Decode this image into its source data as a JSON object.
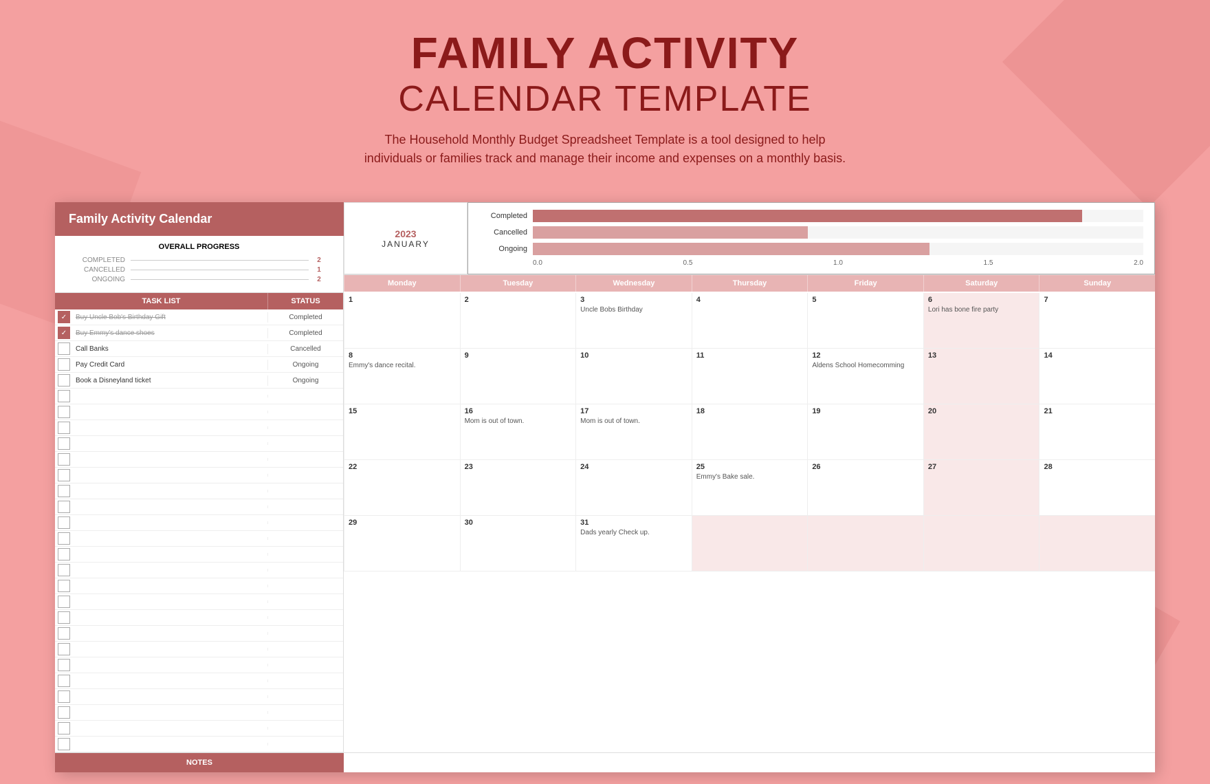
{
  "page": {
    "title_line1": "FAMILY ACTIVITY",
    "title_line2": "CALENDAR TEMPLATE",
    "subtitle": "The Household Monthly Budget Spreadsheet Template is a tool designed to help\nindividuals or families track and manage their income and expenses on a monthly basis."
  },
  "spreadsheet": {
    "title": "Family Activity Calendar",
    "year": "2023",
    "month": "JANUARY",
    "progress": {
      "title": "OVERALL PROGRESS",
      "completed_label": "COMPLETED",
      "completed_value": "2",
      "cancelled_label": "CANCELLED",
      "cancelled_value": "1",
      "ongoing_label": "ONGOING",
      "ongoing_value": "2"
    },
    "chart": {
      "completed_label": "Completed",
      "cancelled_label": "Cancelled",
      "ongoing_label": "Ongoing",
      "axis": [
        "0.0",
        "0.5",
        "1.0",
        "1.5",
        "2.0"
      ]
    },
    "tasks": [
      {
        "checked": true,
        "name": "Buy Uncle Bob's Birthday Gift",
        "strikethrough": true,
        "status": "Completed"
      },
      {
        "checked": true,
        "name": "Buy Emmy's dance shoes",
        "strikethrough": true,
        "status": "Completed"
      },
      {
        "checked": false,
        "name": "Call Banks",
        "strikethrough": false,
        "status": "Cancelled"
      },
      {
        "checked": false,
        "name": "Pay Credit Card",
        "strikethrough": false,
        "status": "Ongoing"
      },
      {
        "checked": false,
        "name": "Book a Disneyland ticket",
        "strikethrough": false,
        "status": "Ongoing"
      },
      {
        "checked": false,
        "name": "",
        "strikethrough": false,
        "status": ""
      },
      {
        "checked": false,
        "name": "",
        "strikethrough": false,
        "status": ""
      },
      {
        "checked": false,
        "name": "",
        "strikethrough": false,
        "status": ""
      },
      {
        "checked": false,
        "name": "",
        "strikethrough": false,
        "status": ""
      },
      {
        "checked": false,
        "name": "",
        "strikethrough": false,
        "status": ""
      },
      {
        "checked": false,
        "name": "",
        "strikethrough": false,
        "status": ""
      },
      {
        "checked": false,
        "name": "",
        "strikethrough": false,
        "status": ""
      },
      {
        "checked": false,
        "name": "",
        "strikethrough": false,
        "status": ""
      },
      {
        "checked": false,
        "name": "",
        "strikethrough": false,
        "status": ""
      },
      {
        "checked": false,
        "name": "",
        "strikethrough": false,
        "status": ""
      },
      {
        "checked": false,
        "name": "",
        "strikethrough": false,
        "status": ""
      },
      {
        "checked": false,
        "name": "",
        "strikethrough": false,
        "status": ""
      },
      {
        "checked": false,
        "name": "",
        "strikethrough": false,
        "status": ""
      },
      {
        "checked": false,
        "name": "",
        "strikethrough": false,
        "status": ""
      },
      {
        "checked": false,
        "name": "",
        "strikethrough": false,
        "status": ""
      },
      {
        "checked": false,
        "name": "",
        "strikethrough": false,
        "status": ""
      },
      {
        "checked": false,
        "name": "",
        "strikethrough": false,
        "status": ""
      },
      {
        "checked": false,
        "name": "",
        "strikethrough": false,
        "status": ""
      },
      {
        "checked": false,
        "name": "",
        "strikethrough": false,
        "status": ""
      },
      {
        "checked": false,
        "name": "",
        "strikethrough": false,
        "status": ""
      },
      {
        "checked": false,
        "name": "",
        "strikethrough": false,
        "status": ""
      },
      {
        "checked": false,
        "name": "",
        "strikethrough": false,
        "status": ""
      },
      {
        "checked": false,
        "name": "",
        "strikethrough": false,
        "status": ""
      }
    ],
    "days": [
      "Monday",
      "Tuesday",
      "Wednesday",
      "Thursday",
      "Friday",
      "Saturday",
      "Sunday"
    ],
    "weeks": [
      [
        {
          "num": "1",
          "event": ""
        },
        {
          "num": "2",
          "event": ""
        },
        {
          "num": "3",
          "event": "Uncle Bobs Birthday"
        },
        {
          "num": "4",
          "event": ""
        },
        {
          "num": "5",
          "event": ""
        },
        {
          "num": "6",
          "event": "Lori has bone fire party",
          "shaded": true
        },
        {
          "num": "7",
          "event": ""
        }
      ],
      [
        {
          "num": "8",
          "event": "Emmy's dance recital."
        },
        {
          "num": "9",
          "event": ""
        },
        {
          "num": "10",
          "event": ""
        },
        {
          "num": "11",
          "event": ""
        },
        {
          "num": "12",
          "event": "Aldens School Homecomming"
        },
        {
          "num": "13",
          "event": "",
          "shaded": true
        },
        {
          "num": "14",
          "event": ""
        }
      ],
      [
        {
          "num": "15",
          "event": ""
        },
        {
          "num": "16",
          "event": "Mom is out of town."
        },
        {
          "num": "17",
          "event": "Mom is out of town."
        },
        {
          "num": "18",
          "event": ""
        },
        {
          "num": "19",
          "event": ""
        },
        {
          "num": "20",
          "event": "",
          "shaded": true
        },
        {
          "num": "21",
          "event": ""
        }
      ],
      [
        {
          "num": "22",
          "event": ""
        },
        {
          "num": "23",
          "event": ""
        },
        {
          "num": "24",
          "event": ""
        },
        {
          "num": "25",
          "event": "Emmy's Bake sale."
        },
        {
          "num": "26",
          "event": ""
        },
        {
          "num": "27",
          "event": "",
          "shaded": true
        },
        {
          "num": "28",
          "event": ""
        }
      ],
      [
        {
          "num": "29",
          "event": ""
        },
        {
          "num": "30",
          "event": ""
        },
        {
          "num": "31",
          "event": "Dads yearly Check up."
        },
        {
          "num": "",
          "event": "",
          "shaded": true
        },
        {
          "num": "",
          "event": "",
          "shaded": true
        },
        {
          "num": "",
          "event": "",
          "shaded": true
        },
        {
          "num": "",
          "event": "",
          "shaded": true
        }
      ]
    ],
    "task_col_label": "TASK LIST",
    "status_col_label": "STATUS",
    "notes_label": "NOTES"
  }
}
